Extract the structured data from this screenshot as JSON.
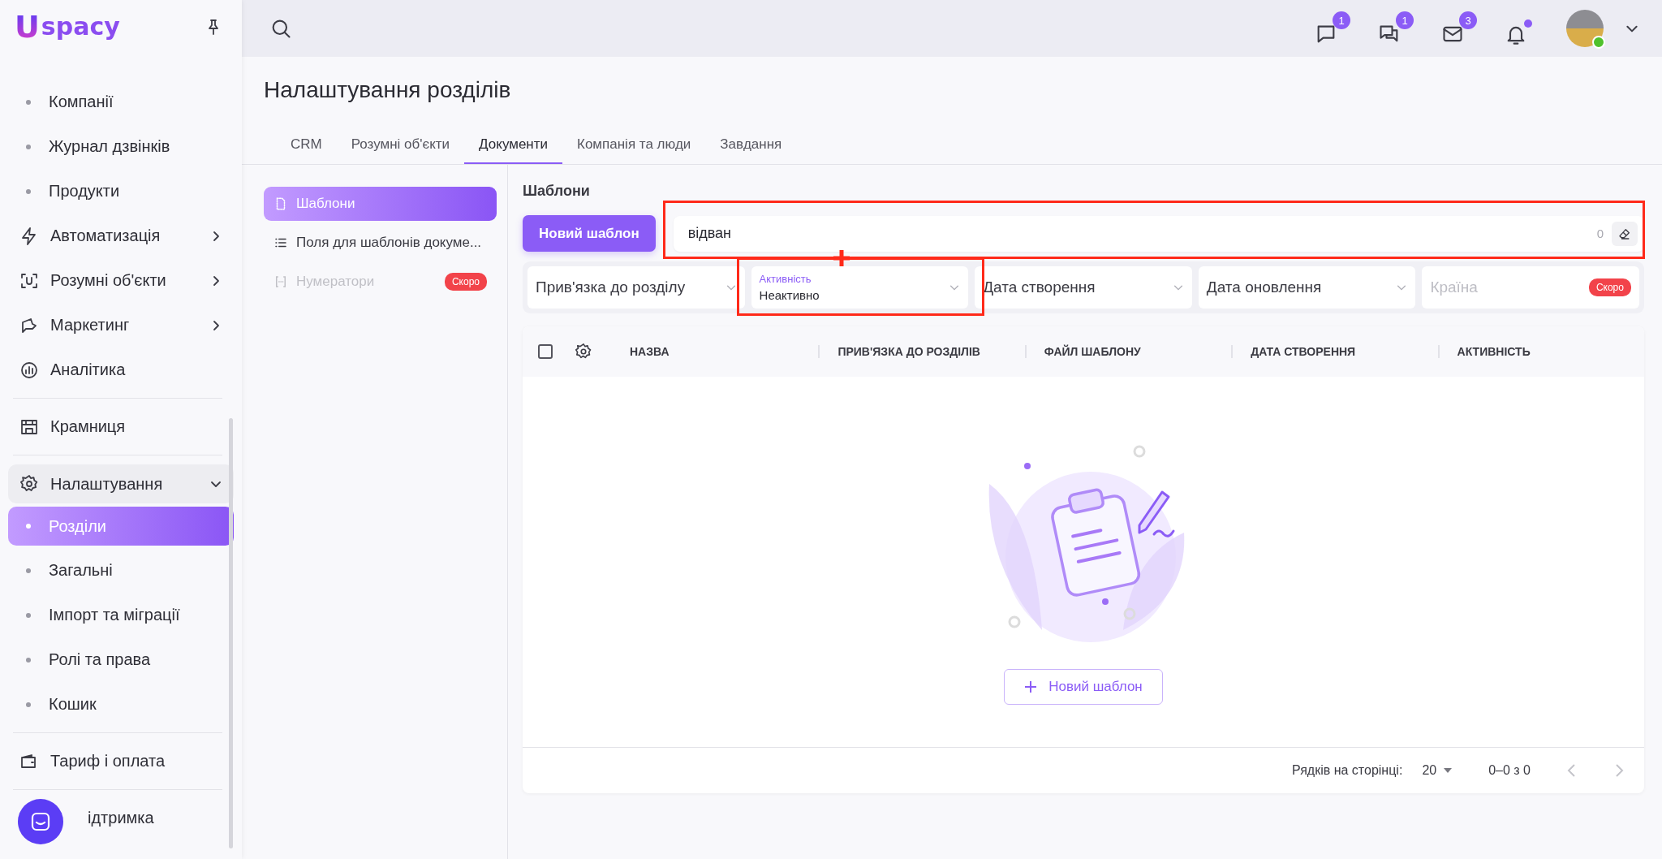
{
  "sidebar": {
    "logo": {
      "mark": "U",
      "text": "spacy"
    },
    "sections": [
      {
        "items": [
          {
            "kind": "sub",
            "label": "Компанії",
            "selected": false
          },
          {
            "kind": "sub",
            "label": "Журнал дзвінків",
            "selected": false
          },
          {
            "kind": "sub",
            "label": "Продукти",
            "selected": false
          },
          {
            "kind": "group",
            "label": "Автоматизація",
            "expanded": false
          },
          {
            "kind": "group",
            "label": "Розумні об'єкти",
            "expanded": false
          },
          {
            "kind": "group",
            "label": "Маркетинг",
            "expanded": false
          },
          {
            "kind": "link",
            "label": "Аналітика"
          }
        ]
      },
      {
        "items": [
          {
            "kind": "link",
            "label": "Крамниця"
          }
        ]
      },
      {
        "items": [
          {
            "kind": "group",
            "label": "Налаштування",
            "expanded": true
          },
          {
            "kind": "sub",
            "label": "Розділи",
            "selected": true
          },
          {
            "kind": "sub",
            "label": "Загальні",
            "selected": false
          },
          {
            "kind": "sub",
            "label": "Імпорт та міграції",
            "selected": false
          },
          {
            "kind": "sub",
            "label": "Ролі та права",
            "selected": false
          },
          {
            "kind": "sub",
            "label": "Кошик",
            "selected": false
          }
        ]
      },
      {
        "items": [
          {
            "kind": "link",
            "label": "Тариф і оплата"
          }
        ]
      },
      {
        "items": [
          {
            "kind": "link",
            "label": "ідтримка"
          }
        ]
      }
    ]
  },
  "topbar": {
    "notifications": [
      {
        "badge": "1"
      },
      {
        "badge": "1"
      },
      {
        "badge": "3"
      },
      {
        "dot": true
      }
    ],
    "avatar": {
      "online": true
    }
  },
  "page": {
    "title": "Налаштування розділів",
    "tabs": [
      {
        "label": "CRM",
        "selected": false
      },
      {
        "label": "Розумні об'єкти",
        "selected": false
      },
      {
        "label": "Документи",
        "selected": true
      },
      {
        "label": "Компанія та люди",
        "selected": false
      },
      {
        "label": "Завдання",
        "selected": false
      }
    ],
    "subnav": [
      {
        "label": "Шаблони",
        "selected": true,
        "disabled": false
      },
      {
        "label": "Поля для шаблонів докуме...",
        "selected": false,
        "disabled": false
      },
      {
        "label": "Нумератори",
        "selected": false,
        "disabled": true,
        "badge": "Скоро"
      }
    ],
    "section_title": "Шаблони",
    "new_button": "Новий шаблон",
    "search": {
      "value": "відван",
      "count": "0"
    },
    "filters": [
      {
        "label": "Прив'язка до розділу",
        "disabled": false
      },
      {
        "label": "Активність",
        "value": "Неактивно",
        "disabled": false
      },
      {
        "label": "Дата створення",
        "disabled": false
      },
      {
        "label": "Дата оновлення",
        "disabled": false
      },
      {
        "label": "Країна",
        "disabled": true,
        "badge": "Скоро"
      }
    ],
    "table": {
      "select_all_checked": false,
      "columns": [
        "НАЗВА",
        "ПРИВ'ЯЗКА ДО РОЗДІЛІВ",
        "ФАЙЛ ШАБЛОНУ",
        "ДАТА СТВОРЕННЯ",
        "АКТИВНІСТЬ"
      ],
      "empty_button": "Новий шаблон"
    },
    "pagination": {
      "rows_label": "Рядків на сторінці:",
      "rows_per_page": "20",
      "range": "0–0 з 0"
    }
  }
}
